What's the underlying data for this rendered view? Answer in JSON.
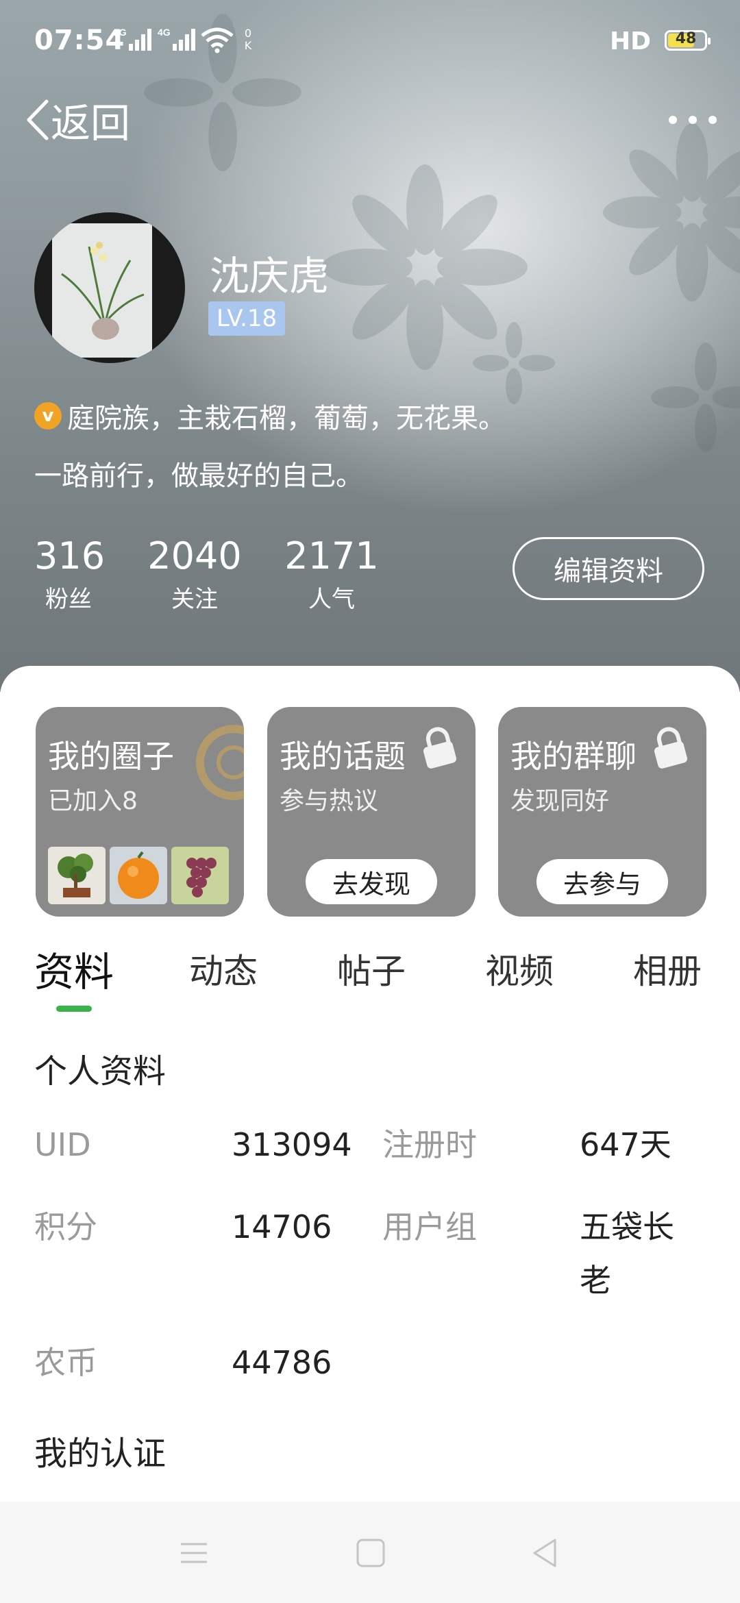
{
  "status_bar": {
    "time": "07:54",
    "network1": "2G",
    "network2": "4G",
    "wifi_speed_top": "0",
    "wifi_speed_bottom": "K",
    "hd": "HD",
    "battery": "48",
    "battery_color": "#f4e04d"
  },
  "nav": {
    "back_label": "返回",
    "more_icon": "more-dots-icon"
  },
  "profile": {
    "name": "沈庆虎",
    "level": "LV.18",
    "bio_line1": "庭院族，主栽石榴，葡萄，无花果。",
    "bio_line2": "一路前行，做最好的自己。",
    "verified_badge": "v",
    "stats": [
      {
        "value": "316",
        "label": "粉丝"
      },
      {
        "value": "2040",
        "label": "关注"
      },
      {
        "value": "2171",
        "label": "人气"
      }
    ],
    "edit_button": "编辑资料"
  },
  "cards": [
    {
      "title": "我的圈子",
      "subtitle": "已加入8"
    },
    {
      "title": "我的话题",
      "subtitle": "参与热议",
      "button": "去发现"
    },
    {
      "title": "我的群聊",
      "subtitle": "发现同好",
      "button": "去参与"
    }
  ],
  "tabs": [
    "资料",
    "动态",
    "帖子",
    "视频",
    "相册"
  ],
  "active_tab": "资料",
  "accent_color": "#3ab44a",
  "personal_info": {
    "title": "个人资料",
    "uid_label": "UID",
    "uid_value": "313094",
    "registered_label": "注册时",
    "registered_value": "647天",
    "points_label": "积分",
    "points_value": "14706",
    "group_label": "用户组",
    "group_value": "五袋长老",
    "coins_label": "农币",
    "coins_value": "44786"
  },
  "certification_title": "我的认证",
  "system_nav": {
    "menu_icon": "menu-icon",
    "home_icon": "home-square-icon",
    "back_icon": "back-triangle-icon"
  }
}
